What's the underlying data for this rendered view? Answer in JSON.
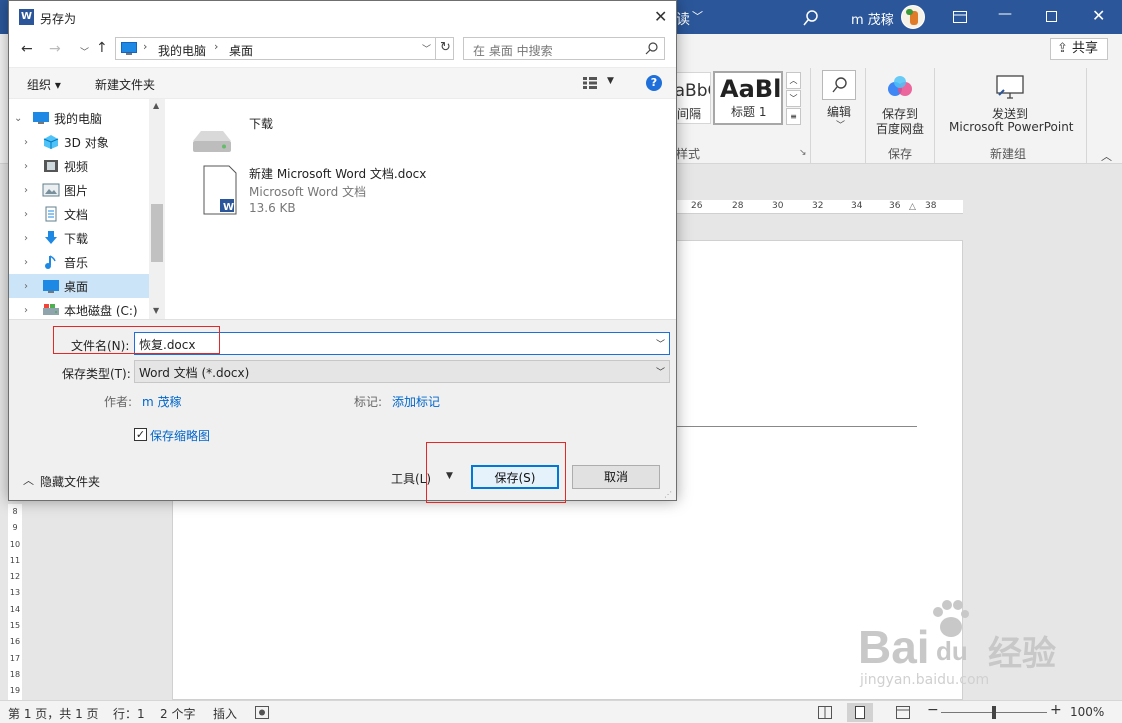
{
  "word": {
    "title_fragment": "读",
    "user": "m 茂稼",
    "share": "共享",
    "styles": [
      {
        "sample": "AaBbCc",
        "label": "间隔"
      },
      {
        "sample": "AaBl",
        "label": "标题 1"
      }
    ],
    "styles_group": "样式",
    "edit_label": "编辑",
    "save_baidu_line1": "保存到",
    "save_baidu_line2": "百度网盘",
    "save_group": "保存",
    "send_line1": "发送到",
    "send_line2": "Microsoft PowerPoint",
    "new_group": "新建组",
    "ruler_marks": [
      "26",
      "28",
      "30",
      "32",
      "34",
      "36",
      "38"
    ],
    "vruler_marks": [
      "8",
      "9",
      "10",
      "11",
      "12",
      "13",
      "14",
      "15",
      "16",
      "17",
      "18",
      "19"
    ],
    "status": {
      "page": "第 1 页，共 1 页",
      "row": "行：1",
      "words": "2 个字",
      "mode": "插入",
      "zoom": "100%"
    },
    "watermark": {
      "brand": "Bai",
      "brand2": "du",
      "sub": "经验",
      "url": "jingyan.baidu.com"
    }
  },
  "dialog": {
    "title": "另存为",
    "path": [
      "我的电脑",
      "桌面"
    ],
    "search_placeholder": "在 桌面 中搜索",
    "organize": "组织 ▾",
    "new_folder": "新建文件夹",
    "tree": [
      {
        "label": "我的电脑",
        "icon": "pc-icon",
        "level": 0
      },
      {
        "label": "3D 对象",
        "icon": "cube-icon",
        "level": 1
      },
      {
        "label": "视频",
        "icon": "video-icon",
        "level": 1
      },
      {
        "label": "图片",
        "icon": "picture-icon",
        "level": 1
      },
      {
        "label": "文档",
        "icon": "document-icon",
        "level": 1
      },
      {
        "label": "下载",
        "icon": "download-icon",
        "level": 1
      },
      {
        "label": "音乐",
        "icon": "music-icon",
        "level": 1
      },
      {
        "label": "桌面",
        "icon": "desktop-icon",
        "level": 1,
        "selected": true
      },
      {
        "label": "本地磁盘 (C:)",
        "icon": "drive-icon",
        "level": 1
      }
    ],
    "files": [
      {
        "name": "下载",
        "type": "",
        "size": ""
      },
      {
        "name": "新建 Microsoft Word 文档.docx",
        "type": "Microsoft Word 文档",
        "size": "13.6 KB"
      }
    ],
    "filename_label": "文件名(N):",
    "filename_value": "恢复.docx",
    "filetype_label": "保存类型(T):",
    "filetype_value": "Word 文档 (*.docx)",
    "author_label": "作者:",
    "author_value": "m 茂稼",
    "tags_label": "标记:",
    "tags_value": "添加标记",
    "thumbnail_label": "保存缩略图",
    "thumbnail_checked": true,
    "hide_folders": "隐藏文件夹",
    "tools": "工具(L)",
    "save": "保存(S)",
    "cancel": "取消"
  }
}
